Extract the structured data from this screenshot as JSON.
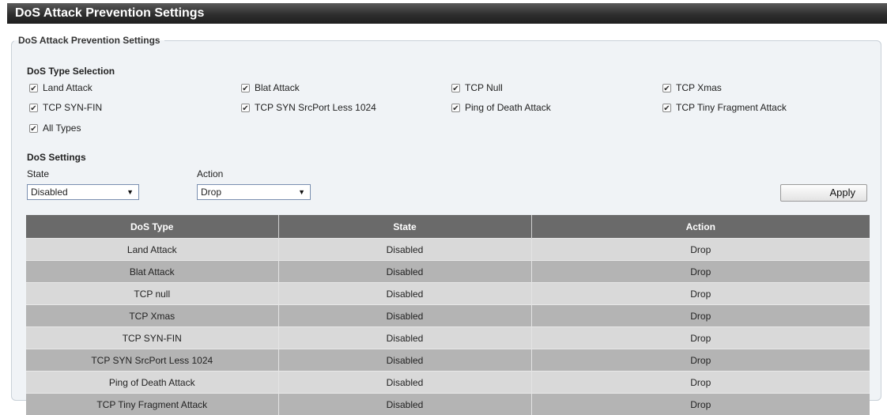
{
  "title": "DoS Attack Prevention Settings",
  "fieldset_legend": "DoS Attack Prevention Settings",
  "type_selection": {
    "title": "DoS Type Selection",
    "items": [
      {
        "label": "Land Attack",
        "checked": true
      },
      {
        "label": "Blat Attack",
        "checked": true
      },
      {
        "label": "TCP Null",
        "checked": true
      },
      {
        "label": "TCP Xmas",
        "checked": true
      },
      {
        "label": "TCP SYN-FIN",
        "checked": true
      },
      {
        "label": "TCP SYN SrcPort Less 1024",
        "checked": true
      },
      {
        "label": "Ping of Death Attack",
        "checked": true
      },
      {
        "label": "TCP Tiny Fragment Attack",
        "checked": true
      },
      {
        "label": "All Types",
        "checked": true
      }
    ]
  },
  "settings": {
    "title": "DoS Settings",
    "state_label": "State",
    "state_value": "Disabled",
    "action_label": "Action",
    "action_value": "Drop",
    "apply_label": "Apply"
  },
  "table": {
    "headers": [
      "DoS Type",
      "State",
      "Action"
    ],
    "rows": [
      [
        "Land Attack",
        "Disabled",
        "Drop"
      ],
      [
        "Blat Attack",
        "Disabled",
        "Drop"
      ],
      [
        "TCP null",
        "Disabled",
        "Drop"
      ],
      [
        "TCP Xmas",
        "Disabled",
        "Drop"
      ],
      [
        "TCP SYN-FIN",
        "Disabled",
        "Drop"
      ],
      [
        "TCP SYN SrcPort Less 1024",
        "Disabled",
        "Drop"
      ],
      [
        "Ping of Death Attack",
        "Disabled",
        "Drop"
      ],
      [
        "TCP Tiny Fragment Attack",
        "Disabled",
        "Drop"
      ]
    ]
  }
}
